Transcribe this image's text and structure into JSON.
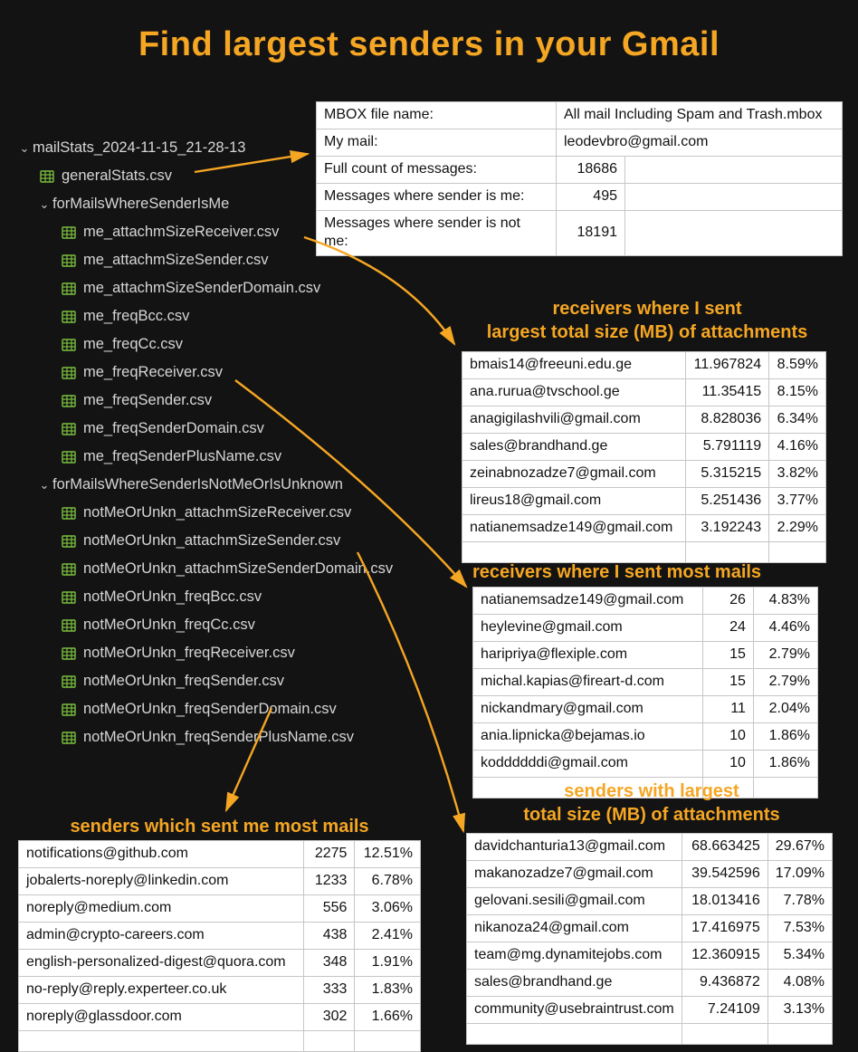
{
  "title": "Find largest senders in your Gmail",
  "tree": {
    "root": "mailStats_2024-11-15_21-28-13",
    "generalStats": "generalStats.csv",
    "folderMe": "forMailsWhereSenderIsMe",
    "meFiles": [
      "me_attachmSizeReceiver.csv",
      "me_attachmSizeSender.csv",
      "me_attachmSizeSenderDomain.csv",
      "me_freqBcc.csv",
      "me_freqCc.csv",
      "me_freqReceiver.csv",
      "me_freqSender.csv",
      "me_freqSenderDomain.csv",
      "me_freqSenderPlusName.csv"
    ],
    "folderNotMe": "forMailsWhereSenderIsNotMeOrIsUnknown",
    "notMeFiles": [
      "notMeOrUnkn_attachmSizeReceiver.csv",
      "notMeOrUnkn_attachmSizeSender.csv",
      "notMeOrUnkn_attachmSizeSenderDomain.csv",
      "notMeOrUnkn_freqBcc.csv",
      "notMeOrUnkn_freqCc.csv",
      "notMeOrUnkn_freqReceiver.csv",
      "notMeOrUnkn_freqSender.csv",
      "notMeOrUnkn_freqSenderDomain.csv",
      "notMeOrUnkn_freqSenderPlusName.csv"
    ]
  },
  "generalStats": {
    "rows": [
      {
        "label": "MBOX file name:",
        "value": "All mail Including Spam and Trash.mbox"
      },
      {
        "label": "My mail:",
        "value": "leodevbro@gmail.com"
      },
      {
        "label": "Full count of messages:",
        "value": "18686"
      },
      {
        "label": "Messages where sender is me:",
        "value": "495"
      },
      {
        "label": "Messages where sender is not me:",
        "value": "18191"
      }
    ]
  },
  "captions": {
    "attSize": "receivers where I sent\nlargest total size (MB) of attachments",
    "mostMailsRecv": "receivers where I sent most mails",
    "sendersAttSize": "senders with largest\ntotal size (MB) of attachments",
    "sendersMostMails": "senders which sent me most mails"
  },
  "tables": {
    "attSize": {
      "rows": [
        {
          "who": "bmais14@freeuni.edu.ge",
          "size": "11.967824",
          "pct": "8.59%"
        },
        {
          "who": "ana.rurua@tvschool.ge",
          "size": "11.35415",
          "pct": "8.15%"
        },
        {
          "who": "anagigilashvili@gmail.com",
          "size": "8.828036",
          "pct": "6.34%"
        },
        {
          "who": "sales@brandhand.ge",
          "size": "5.791119",
          "pct": "4.16%"
        },
        {
          "who": "zeinabnozadze7@gmail.com",
          "size": "5.315215",
          "pct": "3.82%"
        },
        {
          "who": "lireus18@gmail.com",
          "size": "5.251436",
          "pct": "3.77%"
        },
        {
          "who": "natianemsadze149@gmail.com",
          "size": "3.192243",
          "pct": "2.29%"
        }
      ]
    },
    "mostMailsRecv": {
      "rows": [
        {
          "who": "natianemsadze149@gmail.com",
          "cnt": "26",
          "pct": "4.83%"
        },
        {
          "who": "heylevine@gmail.com",
          "cnt": "24",
          "pct": "4.46%"
        },
        {
          "who": "haripriya@flexiple.com",
          "cnt": "15",
          "pct": "2.79%"
        },
        {
          "who": "michal.kapias@fireart-d.com",
          "cnt": "15",
          "pct": "2.79%"
        },
        {
          "who": "nickandmary@gmail.com",
          "cnt": "11",
          "pct": "2.04%"
        },
        {
          "who": "ania.lipnicka@bejamas.io",
          "cnt": "10",
          "pct": "1.86%"
        },
        {
          "who": "koddddddi@gmail.com",
          "cnt": "10",
          "pct": "1.86%"
        }
      ]
    },
    "sendersAttSize": {
      "rows": [
        {
          "who": "davidchanturia13@gmail.com",
          "size": "68.663425",
          "pct": "29.67%"
        },
        {
          "who": "makanozadze7@gmail.com",
          "size": "39.542596",
          "pct": "17.09%"
        },
        {
          "who": "gelovani.sesili@gmail.com",
          "size": "18.013416",
          "pct": "7.78%"
        },
        {
          "who": "nikanoza24@gmail.com",
          "size": "17.416975",
          "pct": "7.53%"
        },
        {
          "who": "team@mg.dynamitejobs.com",
          "size": "12.360915",
          "pct": "5.34%"
        },
        {
          "who": "sales@brandhand.ge",
          "size": "9.436872",
          "pct": "4.08%"
        },
        {
          "who": "community@usebraintrust.com",
          "size": "7.24109",
          "pct": "3.13%"
        }
      ]
    },
    "sendersMostMails": {
      "rows": [
        {
          "who": "notifications@github.com",
          "cnt": "2275",
          "pct": "12.51%"
        },
        {
          "who": "jobalerts-noreply@linkedin.com",
          "cnt": "1233",
          "pct": "6.78%"
        },
        {
          "who": "noreply@medium.com",
          "cnt": "556",
          "pct": "3.06%"
        },
        {
          "who": "admin@crypto-careers.com",
          "cnt": "438",
          "pct": "2.41%"
        },
        {
          "who": "english-personalized-digest@quora.com",
          "cnt": "348",
          "pct": "1.91%"
        },
        {
          "who": "no-reply@reply.experteer.co.uk",
          "cnt": "333",
          "pct": "1.83%"
        },
        {
          "who": "noreply@glassdoor.com",
          "cnt": "302",
          "pct": "1.66%"
        }
      ]
    }
  }
}
